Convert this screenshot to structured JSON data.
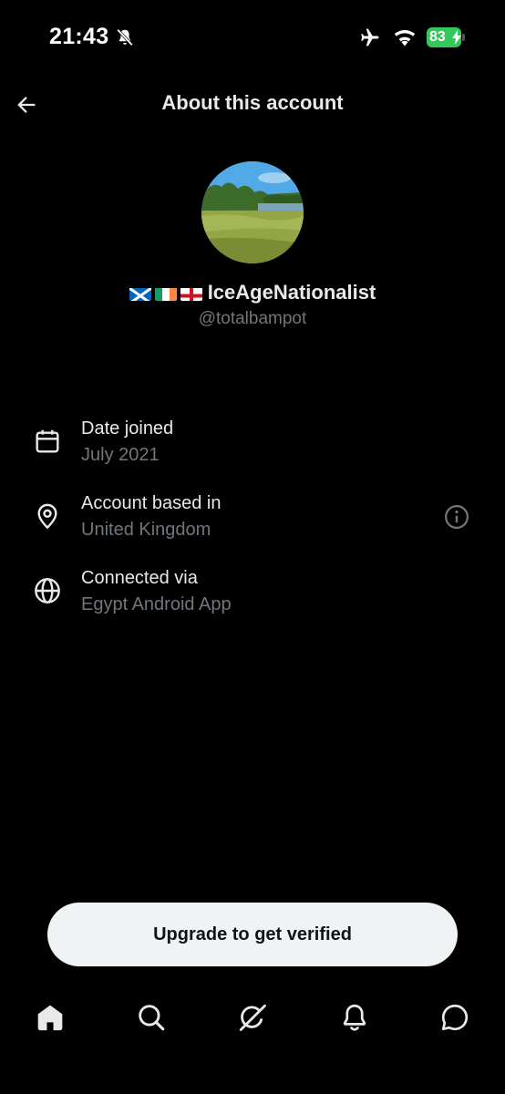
{
  "status_bar": {
    "time": "21:43",
    "battery_level": "83",
    "battery_color": "#34c759",
    "icons": [
      "bell-slash-icon",
      "airplane-icon",
      "wifi-icon",
      "battery-icon"
    ]
  },
  "header": {
    "title": "About this account",
    "back_icon": "arrow-left-icon"
  },
  "profile": {
    "flags": [
      "scotland-flag",
      "ireland-flag",
      "england-flag"
    ],
    "display_name": "IceAgeNationalist",
    "handle": "@totalbampot"
  },
  "info": [
    {
      "icon": "calendar-icon",
      "label": "Date joined",
      "value": "July 2021"
    },
    {
      "icon": "location-pin-icon",
      "label": "Account based in",
      "value": "United Kingdom",
      "help_icon": "info-icon"
    },
    {
      "icon": "globe-icon",
      "label": "Connected via",
      "value": "Egypt Android App"
    }
  ],
  "upgrade_button": {
    "label": "Upgrade to get verified"
  },
  "bottom_nav": [
    {
      "name": "home",
      "icon": "home-icon",
      "active": true
    },
    {
      "name": "search",
      "icon": "search-icon"
    },
    {
      "name": "grok",
      "icon": "grok-icon"
    },
    {
      "name": "notifications",
      "icon": "bell-icon"
    },
    {
      "name": "messages",
      "icon": "chat-bubble-icon"
    }
  ],
  "colors": {
    "background": "#000000",
    "primary_text": "#e7e9ea",
    "secondary_text": "#71767b",
    "button_bg": "#eff3f4"
  }
}
